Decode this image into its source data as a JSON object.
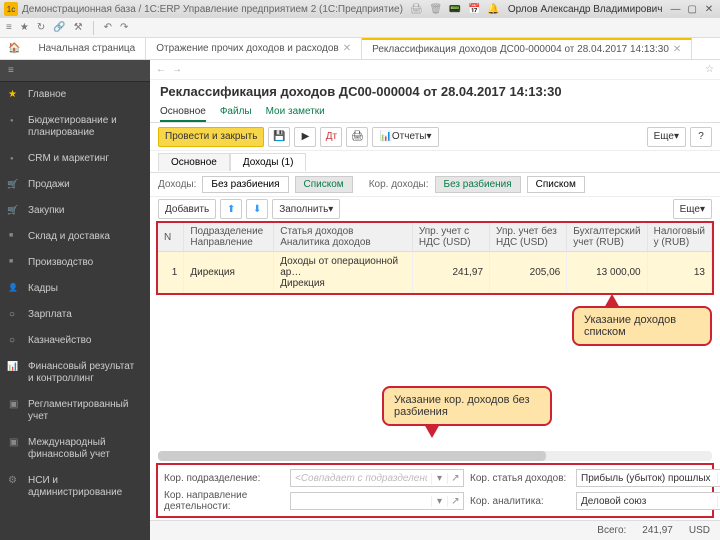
{
  "titlebar": {
    "title": "Демонстрационная база / 1C:ERP Управление предприятием 2  (1С:Предприятие)",
    "user": "Орлов Александр Владимирович"
  },
  "tabs": {
    "home": "Начальная страница",
    "t1": "Отражение прочих доходов и расходов",
    "t2": "Реклассификация доходов ДС00-000004 от 28.04.2017 14:13:30"
  },
  "doc": {
    "title": "Реклассификация доходов ДС00-000004 от 28.04.2017 14:13:30"
  },
  "mini": {
    "main": "Основное",
    "files": "Файлы",
    "notes": "Мои заметки"
  },
  "actions": {
    "post_close": "Провести и закрыть",
    "reports": "Отчеты",
    "more": "Еще"
  },
  "subtabs": {
    "main": "Основное",
    "income": "Доходы (1)"
  },
  "filters": {
    "income_label": "Доходы:",
    "no_split": "Без разбиения",
    "list": "Списком",
    "cor_label": "Кор. доходы:",
    "cor_no_split": "Без разбиения",
    "cor_list": "Списком"
  },
  "list": {
    "add": "Добавить",
    "fill": "Заполнить",
    "more": "Еще"
  },
  "cols": {
    "n": "N",
    "dept": "Подразделение",
    "dept_sub": "Направление",
    "article": "Статья доходов",
    "article_sub": "Аналитика доходов",
    "vat_usd": "Упр. учет с НДС (USD)",
    "novat_usd": "Упр. учет без НДС (USD)",
    "acc_rub": "Бухгалтерский учет (RUB)",
    "tax_rub": "Налоговый у (RUB)"
  },
  "row1": {
    "n": "1",
    "dept": "Дирекция",
    "article": "Доходы от операционной ар…",
    "article2": "Дирекция",
    "vat": "241,97",
    "novat": "205,06",
    "acc": "13 000,00",
    "tax": "13"
  },
  "callouts": {
    "top": "Указание доходов списком",
    "bottom": "Указание кор. доходов без разбиения"
  },
  "bottom": {
    "cor_dept_lbl": "Кор. подразделение:",
    "cor_dept_ph": "<Совпадает с подразделением>",
    "cor_art_lbl": "Кор. статья доходов:",
    "cor_art_val": "Прибыль (убыток) прошлых лет",
    "cor_dir_lbl": "Кор. направление деятельности:",
    "cor_an_lbl": "Кор. аналитика:",
    "cor_an_val": "Деловой союз"
  },
  "totals": {
    "label": "Всего:",
    "sum": "241,97",
    "cur": "USD"
  },
  "sidebar": {
    "items": [
      {
        "label": "Главное"
      },
      {
        "label": "Бюджетирование и планирование"
      },
      {
        "label": "CRM и маркетинг"
      },
      {
        "label": "Продажи"
      },
      {
        "label": "Закупки"
      },
      {
        "label": "Склад и доставка"
      },
      {
        "label": "Производство"
      },
      {
        "label": "Кадры"
      },
      {
        "label": "Зарплата"
      },
      {
        "label": "Казначейство"
      },
      {
        "label": "Финансовый результат и контроллинг"
      },
      {
        "label": "Регламентированный учет"
      },
      {
        "label": "Международный финансовый учет"
      },
      {
        "label": "НСИ и администрирование"
      }
    ]
  }
}
